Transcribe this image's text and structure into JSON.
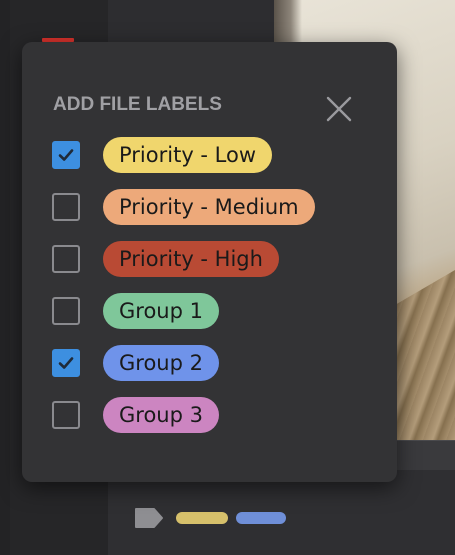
{
  "popup": {
    "title": "ADD FILE LABELS",
    "close_icon": "close-icon"
  },
  "labels": [
    {
      "name": "Priority - Low",
      "color": "#f0d66d",
      "checked": true
    },
    {
      "name": "Priority - Medium",
      "color": "#eda97a",
      "checked": false
    },
    {
      "name": "Priority - High",
      "color": "#b94a34",
      "checked": false
    },
    {
      "name": "Group 1",
      "color": "#7fc79a",
      "checked": false
    },
    {
      "name": "Group 2",
      "color": "#6f93ea",
      "checked": true
    },
    {
      "name": "Group 3",
      "color": "#cc85c1",
      "checked": false
    }
  ],
  "background": {
    "accent_red": "#d8322c",
    "tag_icon": "tag-icon",
    "applied_label_colors": [
      "#d6c06b",
      "#6f8fd8"
    ]
  }
}
